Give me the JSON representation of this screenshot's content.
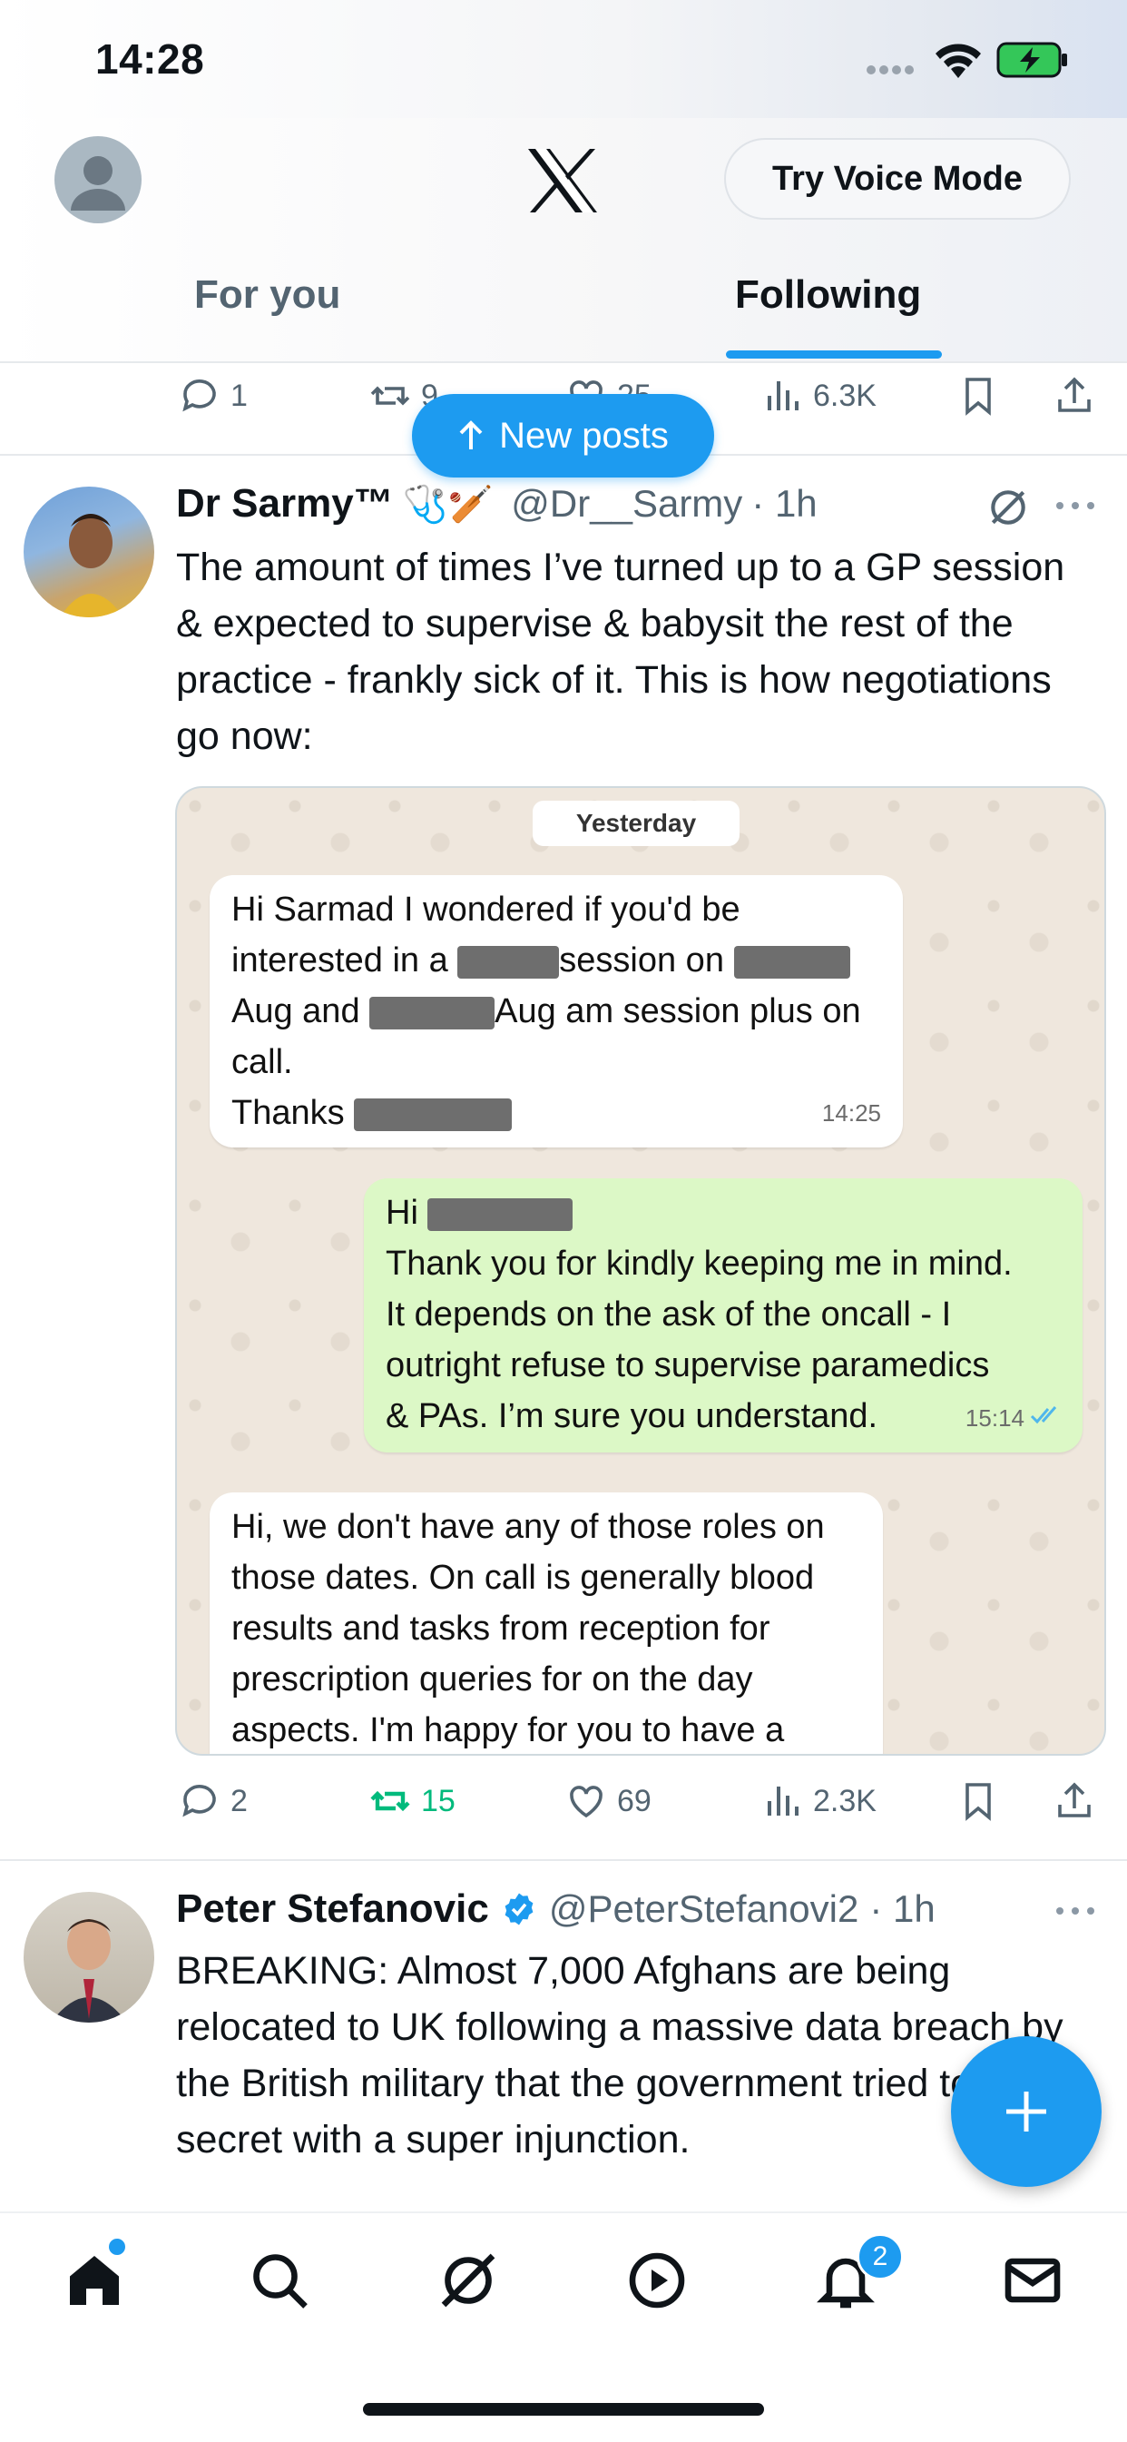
{
  "status_bar": {
    "time": "14:28"
  },
  "header": {
    "voice_button": "Try Voice Mode",
    "tabs": [
      {
        "label": "For you",
        "active": false
      },
      {
        "label": "Following",
        "active": true
      }
    ]
  },
  "prev_post_actions": {
    "replies": "1",
    "reposts": "9",
    "likes": "25",
    "views": "6.3K"
  },
  "new_posts_label": "New posts",
  "post1": {
    "name": "Dr Sarmy™",
    "name_emoji": "🩺🏏",
    "handle": "@Dr__Sarmy",
    "time": "· 1h",
    "text": "The amount of times I’ve turned up to a GP session & expected to supervise & babysit the rest of the practice - frankly sick of it. This is how negotiations go now:",
    "image": {
      "date_chip": "Yesterday",
      "msg1": {
        "line1": "Hi Sarmad I wondered if you'd be",
        "line2_a": "interested in a",
        "line2_b": "session on",
        "line3_a": "Aug and",
        "line3_b": "Aug am session plus on",
        "line4": "call.",
        "line5": "Thanks",
        "time": "14:25"
      },
      "msg2": {
        "line1": "Hi",
        "line2": "Thank you for kindly keeping me in mind.",
        "line3": "It depends on the ask of the oncall - I",
        "line4": "outright refuse to supervise paramedics",
        "line5": "& PAs. I’m sure you understand.",
        "time": "15:14"
      },
      "msg3": {
        "line1": "Hi, we don't have any of those roles on",
        "line2": "those dates. On call is generally blood",
        "line3": "results and tasks from reception for",
        "line4": "prescription queries for on the day",
        "line5": "aspects. I'm happy for you to have a"
      }
    },
    "actions": {
      "replies": "2",
      "reposts": "15",
      "likes": "69",
      "views": "2.3K"
    }
  },
  "post2": {
    "name": "Peter Stefanovic",
    "handle": "@PeterStefanovi2",
    "time": "· 1h",
    "text": "BREAKING: Almost 7,000 Afghans are being relocated to UK following a massive data breach by the British military that the government tried to keep secret with a super injunction."
  },
  "bottom_nav": {
    "notifications_badge": "2"
  },
  "colors": {
    "accent": "#1d9bf0",
    "repost_active": "#00ba7c",
    "text_secondary": "#536471"
  },
  "icons": [
    "profile-avatar-icon",
    "x-logo-icon",
    "reply-icon",
    "repost-icon",
    "like-icon",
    "views-icon",
    "bookmark-icon",
    "share-icon",
    "grok-icon",
    "more-icon",
    "verified-icon",
    "compose-plus-icon",
    "home-icon",
    "search-icon",
    "play-icon",
    "bell-icon",
    "mail-icon"
  ]
}
